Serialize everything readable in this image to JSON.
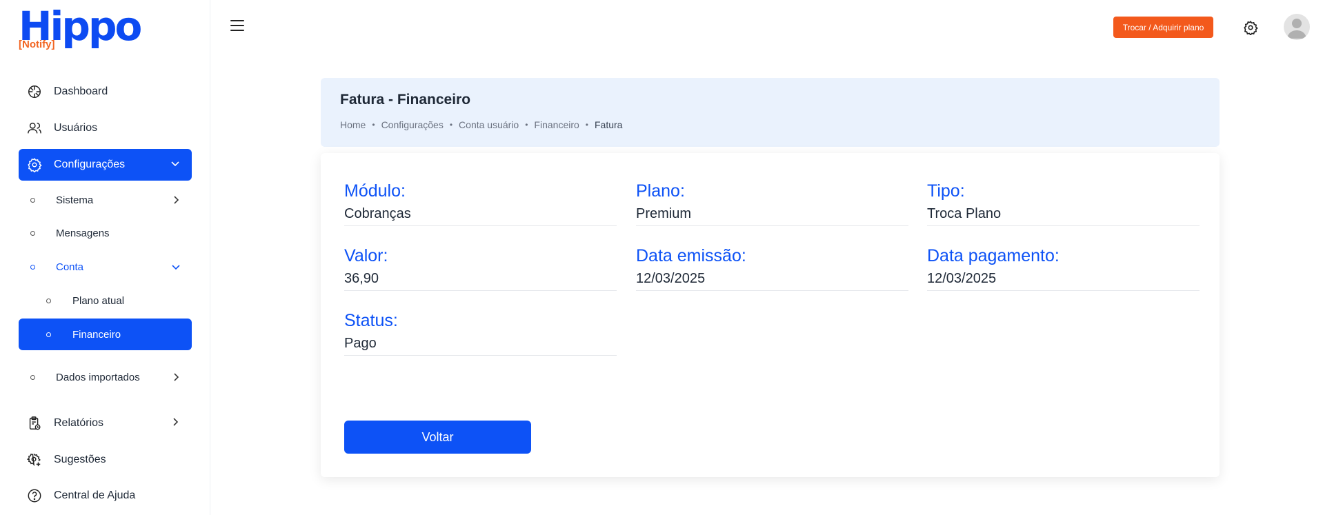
{
  "brand": {
    "name": "Hippo",
    "tag": "[Notify]"
  },
  "sidebar": {
    "items": [
      {
        "label": "Dashboard"
      },
      {
        "label": "Usuários"
      },
      {
        "label": "Configurações"
      },
      {
        "label": "Relatórios"
      },
      {
        "label": "Sugestões"
      },
      {
        "label": "Central de Ajuda"
      }
    ],
    "config_sub": [
      {
        "label": "Sistema"
      },
      {
        "label": "Mensagens"
      },
      {
        "label": "Conta"
      },
      {
        "label": "Dados importados"
      }
    ],
    "conta_sub": [
      {
        "label": "Plano atual"
      },
      {
        "label": "Financeiro"
      }
    ]
  },
  "topbar": {
    "plan_button": "Trocar / Adquirir plano"
  },
  "header": {
    "title": "Fatura - Financeiro",
    "breadcrumb": [
      "Home",
      "Configurações",
      "Conta usuário",
      "Financeiro",
      "Fatura"
    ]
  },
  "invoice": {
    "modulo": {
      "label": "Módulo:",
      "value": "Cobranças"
    },
    "plano": {
      "label": "Plano:",
      "value": "Premium"
    },
    "tipo": {
      "label": "Tipo:",
      "value": "Troca Plano"
    },
    "valor": {
      "label": "Valor:",
      "value": "36,90"
    },
    "data_emissao": {
      "label": "Data emissão:",
      "value": "12/03/2025"
    },
    "data_pagamento": {
      "label": "Data pagamento:",
      "value": "12/03/2025"
    },
    "status": {
      "label": "Status:",
      "value": "Pago"
    }
  },
  "actions": {
    "back_label": "Voltar"
  },
  "colors": {
    "primary": "#0d52f6",
    "accent": "#f3591c",
    "header_bg": "#eaf2fd"
  }
}
